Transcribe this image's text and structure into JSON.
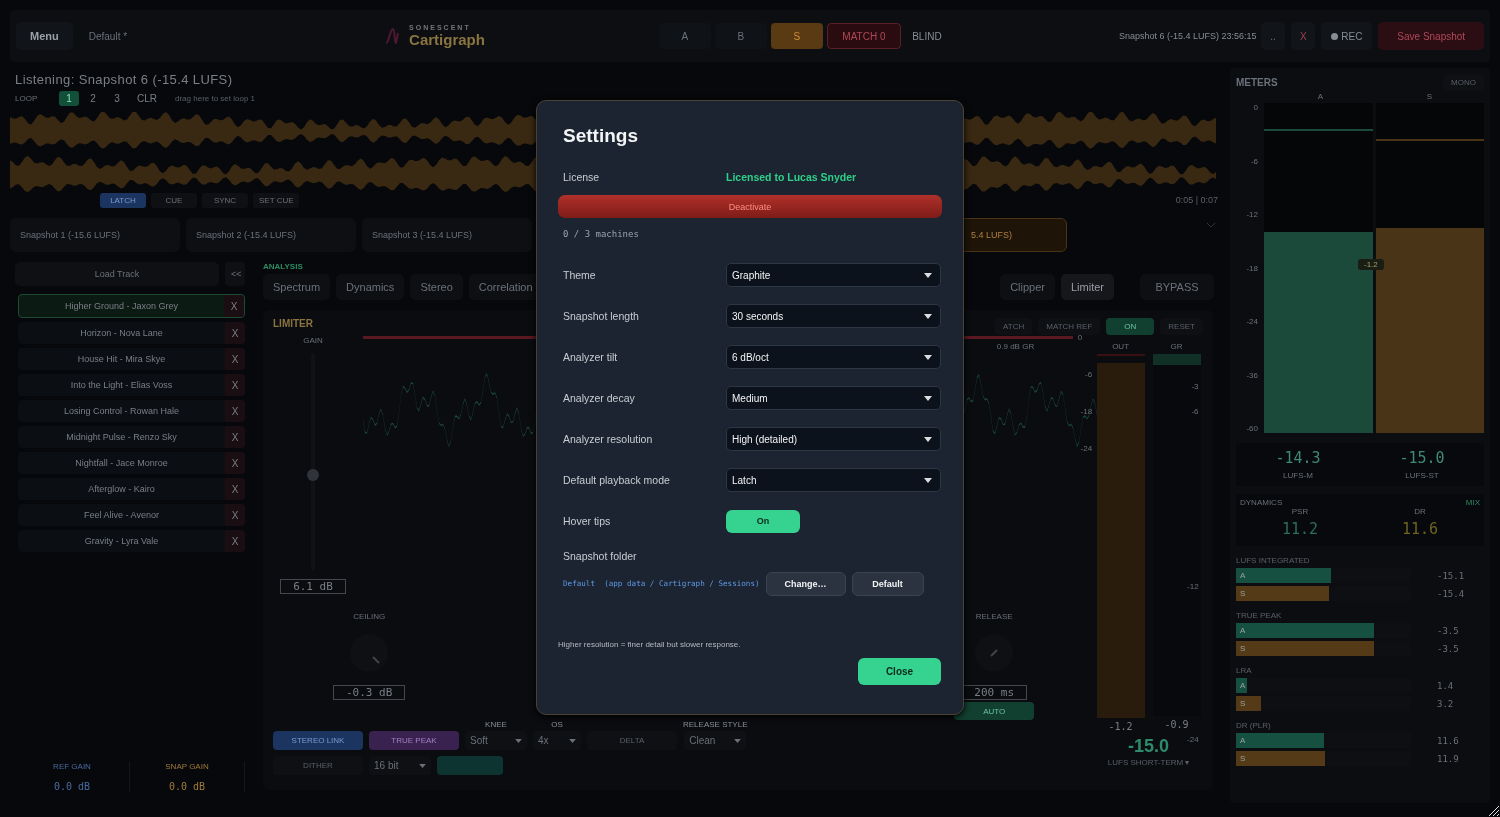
{
  "top_bar": {
    "menu": "Menu",
    "preset": "Default *",
    "brand": {
      "maker": "SONESCENT",
      "name": "Cartigraph"
    },
    "compare": [
      {
        "label": "A",
        "selected": false
      },
      {
        "label": "B",
        "selected": false
      },
      {
        "label": "S",
        "selected": true
      }
    ],
    "match": "MATCH 0",
    "blind": "BLIND",
    "snapshot_select": "Snapshot 6 (-15.4 LUFS) 23:56:15",
    "more": "..",
    "delete": "X",
    "rec": "REC",
    "save": "Save Snapshot"
  },
  "listening": "Listening: Snapshot 6 (-15.4 LUFS)",
  "loop": {
    "label": "LOOP",
    "slots": [
      {
        "label": "1",
        "selected": true
      },
      {
        "label": "2",
        "selected": false
      },
      {
        "label": "3",
        "selected": false
      }
    ],
    "clear": "CLR",
    "hint": "drag here to set loop 1"
  },
  "play_modes": [
    {
      "label": "LATCH",
      "selected": true
    },
    {
      "label": "CUE",
      "selected": false
    },
    {
      "label": "SYNC",
      "selected": false
    },
    {
      "label": "SET CUE",
      "selected": false
    }
  ],
  "time": "0:05 | 0:07",
  "snapshots": [
    {
      "label": "Snapshot 1 (-15.6 LUFS)",
      "selected": false
    },
    {
      "label": "Snapshot 2 (-15.4 LUFS)",
      "selected": false
    },
    {
      "label": "Snapshot 3 (-15.4 LUFS)",
      "selected": false
    },
    {
      "label": "5.4 LUFS)",
      "selected": true
    }
  ],
  "tracks": {
    "load": "Load Track",
    "collapse": "<<",
    "items": [
      {
        "title": "Higher Ground - Jaxon Grey",
        "selected": true,
        "remove": "X"
      },
      {
        "title": "Horizon - Nova Lane",
        "selected": false,
        "remove": "X"
      },
      {
        "title": "House Hit - Mira Skye",
        "selected": false,
        "remove": "X"
      },
      {
        "title": "Into the Light - Elias Voss",
        "selected": false,
        "remove": "X"
      },
      {
        "title": "Losing Control - Rowan Hale",
        "selected": false,
        "remove": "X"
      },
      {
        "title": "Midnight Pulse - Renzo Sky",
        "selected": false,
        "remove": "X"
      },
      {
        "title": "Nightfall - Jace Monroe",
        "selected": false,
        "remove": "X"
      },
      {
        "title": "Afterglow - Kairo",
        "selected": false,
        "remove": "X"
      },
      {
        "title": "Feel Alive - Avenor",
        "selected": false,
        "remove": "X"
      },
      {
        "title": "Gravity - Lyra Vale",
        "selected": false,
        "remove": "X"
      }
    ]
  },
  "gains": [
    {
      "label": "REF GAIN",
      "value": "0.0 dB"
    },
    {
      "label": "SNAP GAIN",
      "value": "0.0 dB"
    }
  ],
  "analysis": {
    "label": "ANALYSIS",
    "tabs": [
      {
        "label": "Spectrum",
        "selected": false
      },
      {
        "label": "Dynamics",
        "selected": false
      },
      {
        "label": "Stereo",
        "selected": false
      },
      {
        "label": "Correlation",
        "selected": false
      }
    ],
    "right_tabs": [
      {
        "label": "Clipper",
        "selected": false
      },
      {
        "label": "Limiter",
        "selected": true
      }
    ],
    "bypass": "BYPASS"
  },
  "limiter": {
    "title": "LIMITER",
    "match": "ATCH",
    "match_ref": "MATCH REF",
    "power": {
      "label": "ON",
      "on": true
    },
    "reset": "RESET",
    "gain": {
      "label": "GAIN",
      "level": 0.44,
      "value": "6.1 dB"
    },
    "ceiling_tick": "0",
    "gr_reading": "0.9 dB GR",
    "scale": [
      "-6",
      "-18",
      "-24"
    ],
    "ceiling": {
      "label": "CEILING",
      "value": "-0.3 dB"
    },
    "release": {
      "label": "RELEASE",
      "value": "200 ms",
      "auto": "AUTO"
    },
    "out": {
      "label": "OUT",
      "level": 0.98,
      "reading": "-1.2"
    },
    "gr": {
      "label": "GR",
      "level": 0.03,
      "reading": "-0.9"
    },
    "gr_scale": [
      "-3",
      "-6",
      "-12",
      "-24"
    ],
    "short_term": "-15.0",
    "short_term_label": "LUFS SHORT-TERM ▾",
    "options": {
      "stereo_link": {
        "label": "STEREO LINK",
        "on": true
      },
      "true_peak": {
        "label": "TRUE PEAK",
        "on": true
      },
      "knee": {
        "label": "KNEE",
        "value": "Soft"
      },
      "os": {
        "label": "OS",
        "value": "4x"
      },
      "delta": "DELTA",
      "release_style": {
        "label": "RELEASE STYLE",
        "value": "Clean"
      },
      "dither": "DITHER",
      "bit_depth": "16 bit"
    }
  },
  "meters": {
    "title": "METERS",
    "mono": "MONO",
    "columns": [
      {
        "label": "A",
        "level": 0.61,
        "color": "#1c4a3a"
      },
      {
        "label": "S",
        "level": 0.62,
        "color": "#4a3418"
      }
    ],
    "scale": [
      "0",
      "-6",
      "-12",
      "-18",
      "-24",
      "-36",
      "-60"
    ],
    "tag": "-1.2",
    "readouts": [
      {
        "value": "-14.3",
        "label": "LUFS-M"
      },
      {
        "value": "-15.0",
        "label": "LUFS-ST"
      }
    ],
    "dynamics": {
      "title": "DYNAMICS",
      "mix": "MIX",
      "items": [
        {
          "label": "PSR",
          "value": "11.2",
          "color": "#2d6e5a"
        },
        {
          "label": "DR",
          "value": "11.6",
          "color": "#6e6420"
        }
      ]
    },
    "groups": [
      {
        "title": "LUFS INTEGRATED",
        "bars": [
          {
            "label": "A",
            "level": 0.54,
            "reading": "-15.1"
          },
          {
            "label": "S",
            "level": 0.53,
            "reading": "-15.4"
          }
        ]
      },
      {
        "title": "TRUE PEAK",
        "bars": [
          {
            "label": "A",
            "level": 0.79,
            "reading": "-3.5"
          },
          {
            "label": "S",
            "level": 0.79,
            "reading": "-3.5"
          }
        ]
      },
      {
        "title": "LRA",
        "bars": [
          {
            "label": "A",
            "level": 0.06,
            "reading": "1.4"
          },
          {
            "label": "S",
            "level": 0.14,
            "reading": "3.2"
          }
        ]
      },
      {
        "title": "DR (PLR)",
        "bars": [
          {
            "label": "A",
            "level": 0.5,
            "reading": "11.6"
          },
          {
            "label": "S",
            "level": 0.51,
            "reading": "11.9"
          }
        ]
      }
    ]
  },
  "settings": {
    "title": "Settings",
    "license_label": "License",
    "license_value": "Licensed to Lucas Snyder",
    "deactivate": "Deactivate",
    "machines": "0 / 3 machines",
    "rows": [
      {
        "kind": "select",
        "label": "Theme",
        "value": "Graphite"
      },
      {
        "kind": "select",
        "label": "Snapshot length",
        "value": "30 seconds"
      },
      {
        "kind": "select",
        "label": "Analyzer tilt",
        "value": "6 dB/oct"
      },
      {
        "kind": "select",
        "label": "Analyzer decay",
        "value": "Medium"
      },
      {
        "kind": "select",
        "label": "Analyzer resolution",
        "value": "High (detailed)"
      },
      {
        "kind": "select",
        "label": "Default playback mode",
        "value": "Latch"
      },
      {
        "kind": "toggle",
        "label": "Hover tips",
        "value": "On",
        "on": true
      }
    ],
    "folder": {
      "label": "Snapshot folder",
      "path": "Default  (app data / Cartigraph / Sessions)",
      "change": "Change…",
      "default": "Default"
    },
    "hint": "Higher resolution = finer detail but slower response.",
    "close": "Close"
  }
}
